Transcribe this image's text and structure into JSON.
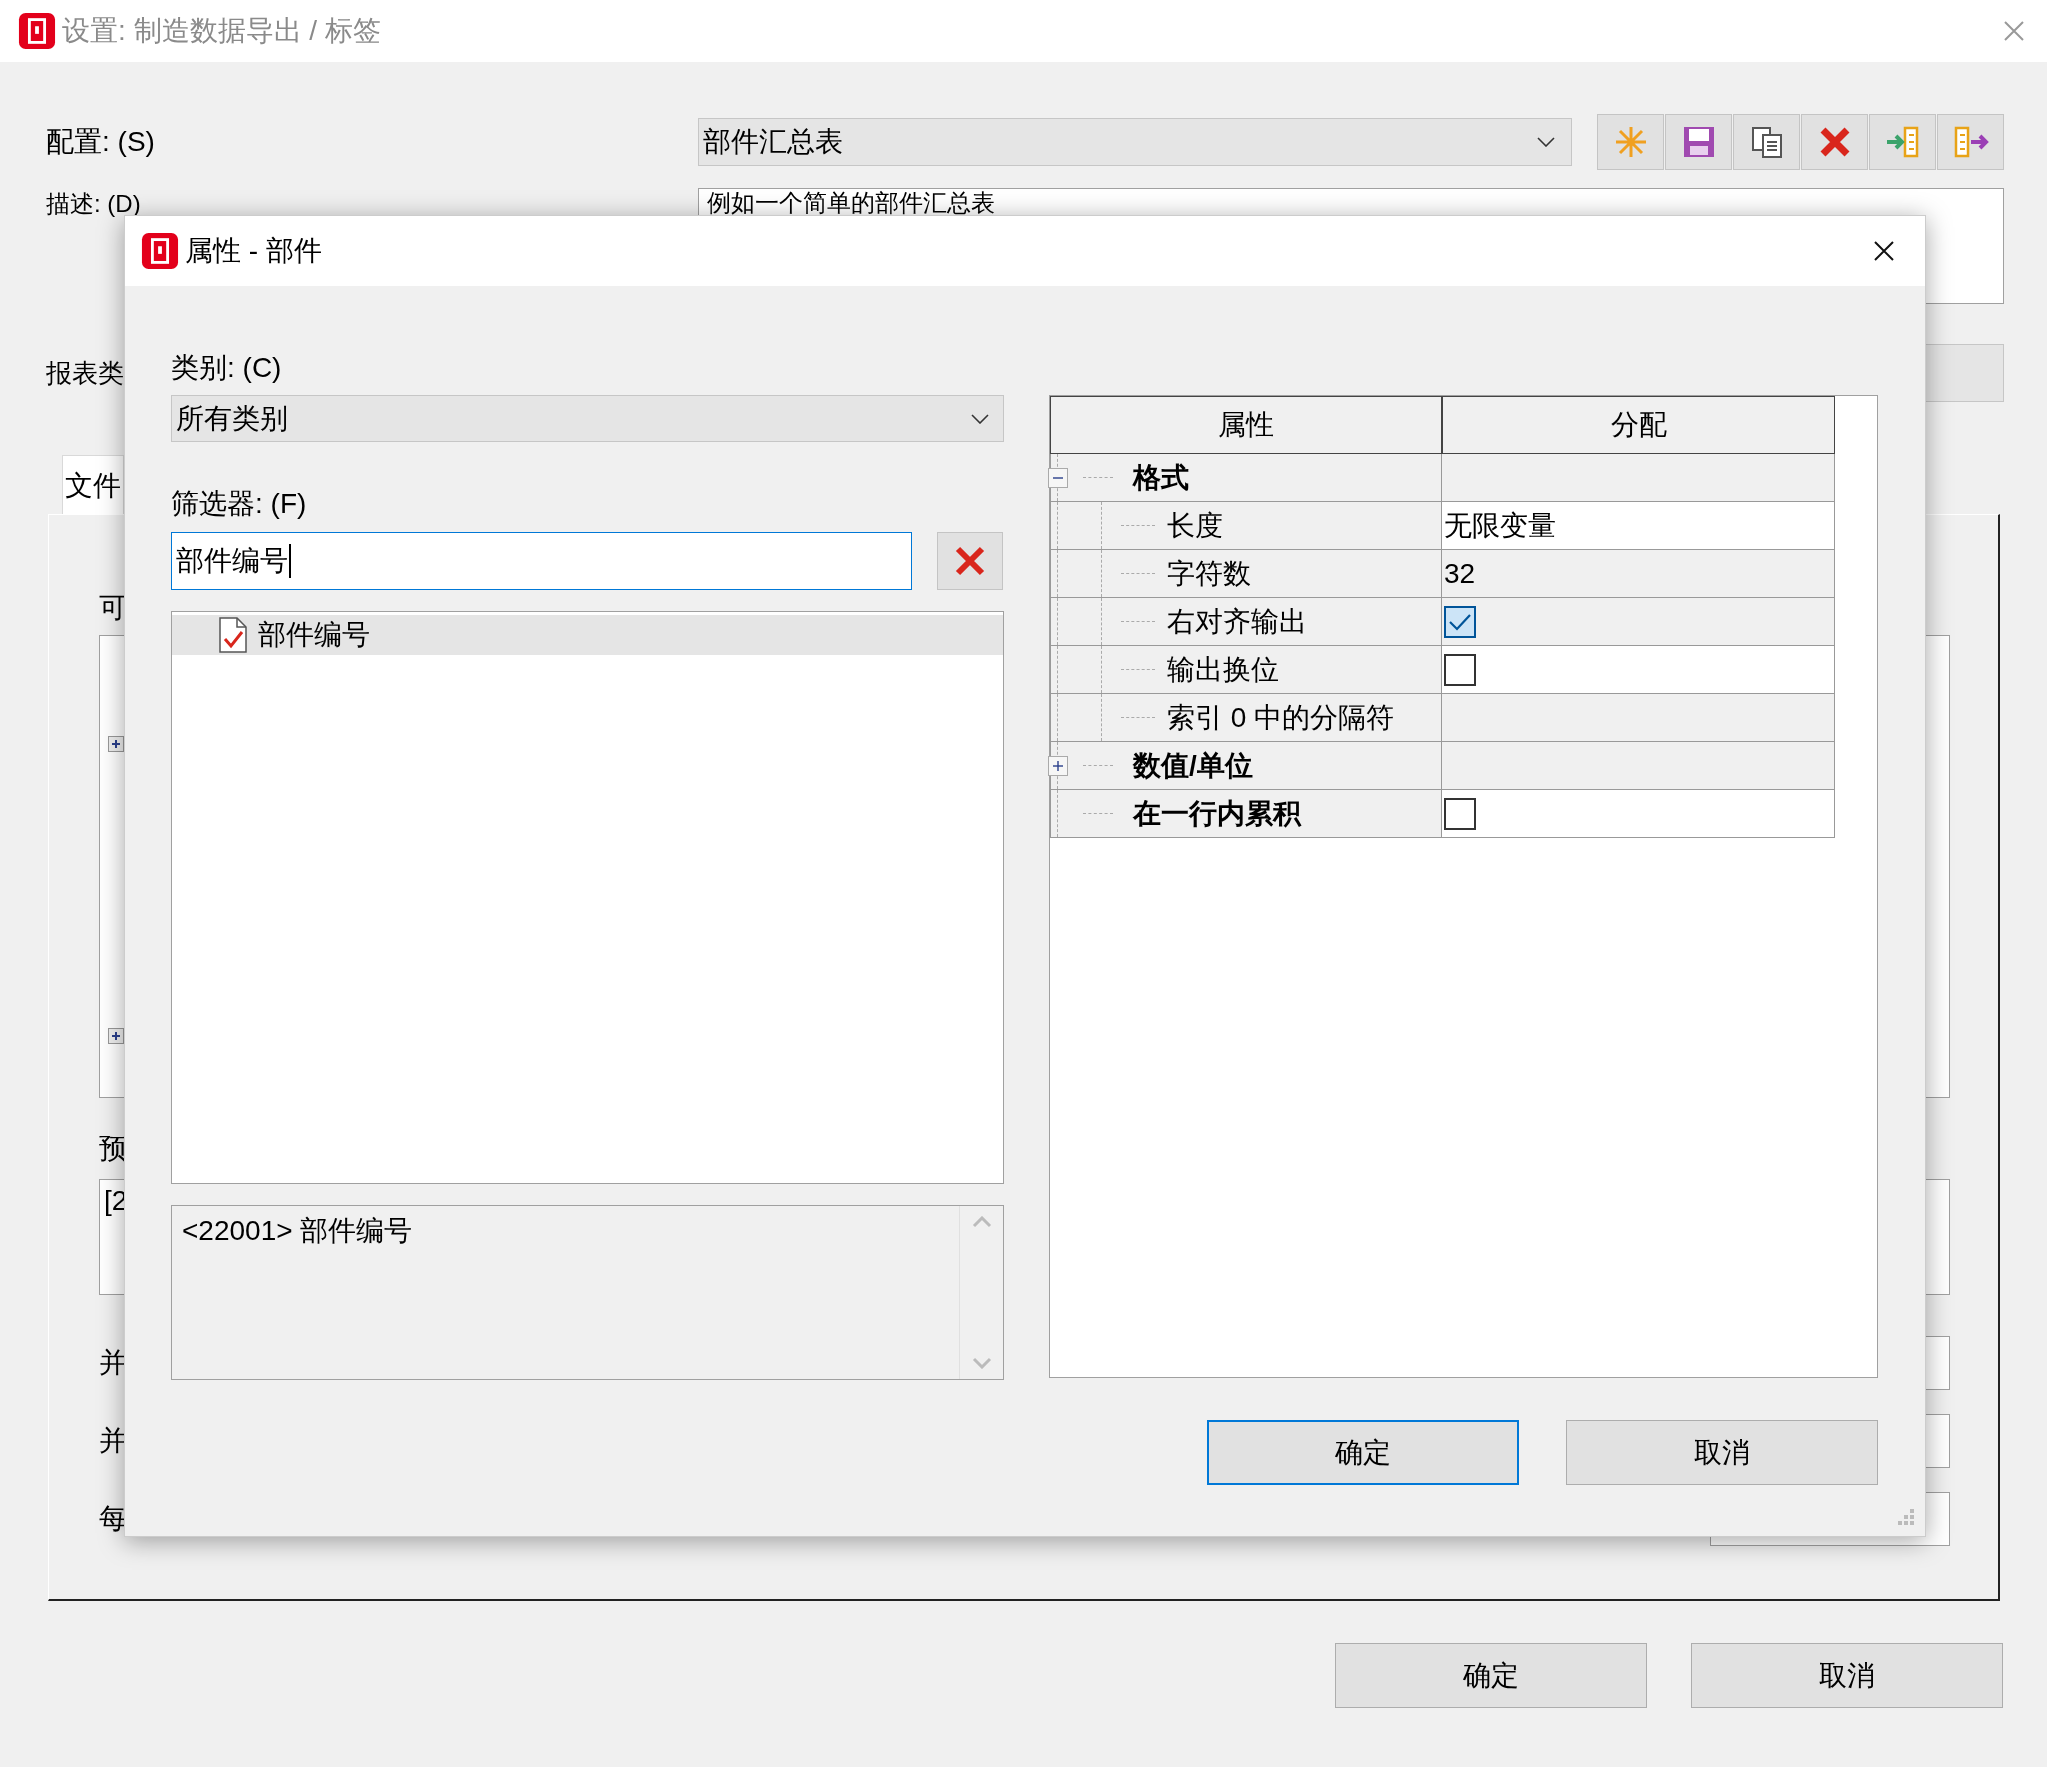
{
  "window": {
    "title": "设置: 制造数据导出 / 标签"
  },
  "config": {
    "label": "配置: (S)",
    "value": "部件汇总表"
  },
  "description": {
    "label": "描述: (D)",
    "value": "例如一个简单的部件汇总表"
  },
  "report_type": {
    "label": "报表类"
  },
  "tabs": [
    {
      "label": "文件",
      "selected": true
    }
  ],
  "panel": {
    "list_label": "可",
    "preview_label": "预",
    "preview_value": "[2",
    "row_labels": [
      "并",
      "并",
      "每"
    ]
  },
  "buttons": [
    {
      "label": "确定",
      "default": false
    },
    {
      "label": "取消",
      "default": false
    }
  ],
  "dialog": {
    "title": "属性 - 部件",
    "category": {
      "label": "类别: (C)",
      "value": "所有类别"
    },
    "filter": {
      "label": "筛选器: (F)",
      "value": "部件编号"
    },
    "results": [
      {
        "label": "部件编号",
        "selected": true
      }
    ],
    "info": "<22001> 部件编号",
    "grid": {
      "columns": [
        "属性",
        "分配"
      ],
      "rows": [
        {
          "label": "格式",
          "kind": "group",
          "expanded": true,
          "children": [
            {
              "label": "长度",
              "kind": "text",
              "value": "无限变量",
              "shaded": false
            },
            {
              "label": "字符数",
              "kind": "text",
              "value": "32",
              "shaded": true
            },
            {
              "label": "右对齐输出",
              "kind": "checkbox",
              "checked": true,
              "shaded": true
            },
            {
              "label": "输出换位",
              "kind": "checkbox",
              "checked": false,
              "shaded": false
            },
            {
              "label": "索引 0 中的分隔符",
              "kind": "empty",
              "shaded": true
            }
          ]
        },
        {
          "label": "数值/单位",
          "kind": "group",
          "expanded": false
        },
        {
          "label": "在一行内累积",
          "kind": "checkbox",
          "checked": false,
          "shaded": false
        }
      ]
    },
    "buttons": [
      {
        "label": "确定",
        "default": true
      },
      {
        "label": "取消",
        "default": false
      }
    ]
  }
}
